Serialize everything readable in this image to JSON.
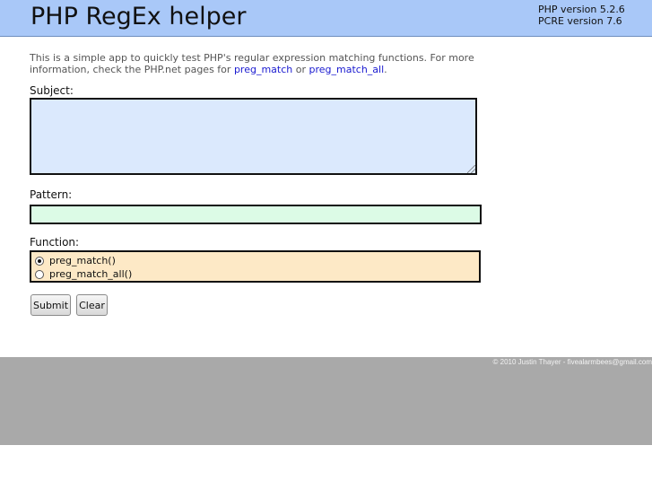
{
  "header": {
    "title": "PHP RegEx helper",
    "php_version": "PHP version 5.2.6",
    "pcre_version": "PCRE version 7.6",
    "background_color": "#a9c8f8"
  },
  "intro": {
    "text_before": "This is a simple app to quickly test PHP's regular expression matching functions. For more information, check the PHP.net pages for ",
    "link1": "preg_match",
    "text_between": " or ",
    "link2": "preg_match_all",
    "text_after": "."
  },
  "form": {
    "subject_label": "Subject:",
    "subject_value": "",
    "pattern_label": "Pattern:",
    "pattern_value": "",
    "function_label": "Function:",
    "functions": [
      {
        "label": "preg_match()",
        "checked": true
      },
      {
        "label": "preg_match_all()",
        "checked": false
      }
    ],
    "submit_label": "Submit",
    "clear_label": "Clear"
  },
  "footer": {
    "copyright": "© 2010 Justin Thayer - fivealarmbees@gmail.com"
  }
}
